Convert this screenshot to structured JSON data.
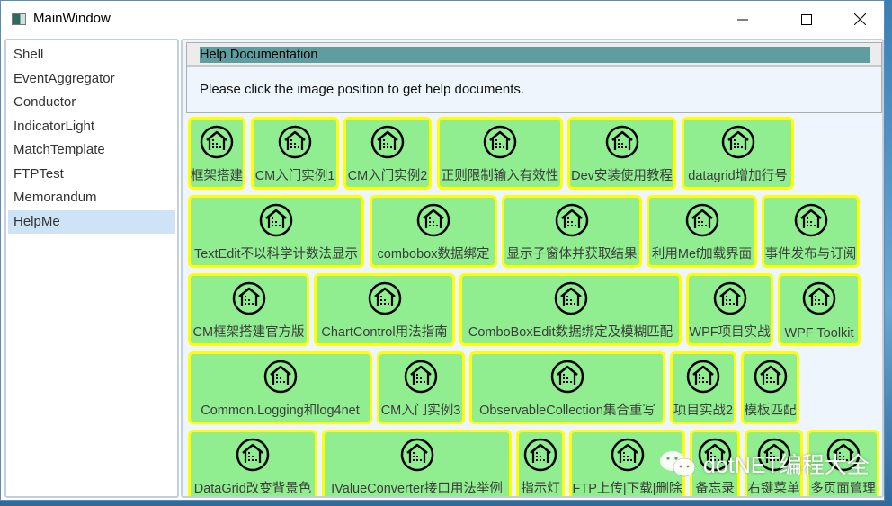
{
  "window": {
    "title": "MainWindow",
    "controls": {
      "minimize": "minimize",
      "maximize": "maximize",
      "close": "close"
    }
  },
  "sidebar": {
    "items": [
      {
        "label": "Shell"
      },
      {
        "label": "EventAggregator"
      },
      {
        "label": "Conductor"
      },
      {
        "label": "IndicatorLight"
      },
      {
        "label": "MatchTemplate"
      },
      {
        "label": "FTPTest"
      },
      {
        "label": "Memorandum"
      },
      {
        "label": "HelpMe",
        "selected": true
      }
    ]
  },
  "help": {
    "header": "Help Documentation",
    "text": "Please click the image position to get help documents.",
    "header_color": "#5f9ea0"
  },
  "tiles_style": {
    "fill": "#90ee90",
    "border": "#ffff00",
    "icon": "house-circle-icon"
  },
  "tiles": [
    {
      "label": "框架搭建"
    },
    {
      "label": "CM入门实例1"
    },
    {
      "label": "CM入门实例2"
    },
    {
      "label": "正则限制输入有效性"
    },
    {
      "label": "Dev安装使用教程"
    },
    {
      "label": "datagrid增加行号"
    },
    {
      "label": "TextEdit不以科学计数法显示"
    },
    {
      "label": "combobox数据绑定"
    },
    {
      "label": "显示子窗体并获取结果"
    },
    {
      "label": "利用Mef加载界面"
    },
    {
      "label": "事件发布与订阅"
    },
    {
      "label": "CM框架搭建官方版"
    },
    {
      "label": "ChartControl用法指南"
    },
    {
      "label": "ComboBoxEdit数据绑定及模糊匹配"
    },
    {
      "label": "WPF项目实战"
    },
    {
      "label": "WPF Toolkit"
    },
    {
      "label": "Common.Logging和log4net"
    },
    {
      "label": "CM入门实例3"
    },
    {
      "label": "ObservableCollection集合重写"
    },
    {
      "label": "项目实战2"
    },
    {
      "label": "模板匹配"
    },
    {
      "label": "DataGrid改变背景色"
    },
    {
      "label": "IValueConverter接口用法举例"
    },
    {
      "label": "指示灯"
    },
    {
      "label": "FTP上传|下载|删除"
    },
    {
      "label": "备忘录"
    },
    {
      "label": "右键菜单"
    },
    {
      "label": "多页面管理"
    }
  ],
  "watermark": {
    "text": "dotNET编程大全",
    "icon": "wechat-icon"
  }
}
